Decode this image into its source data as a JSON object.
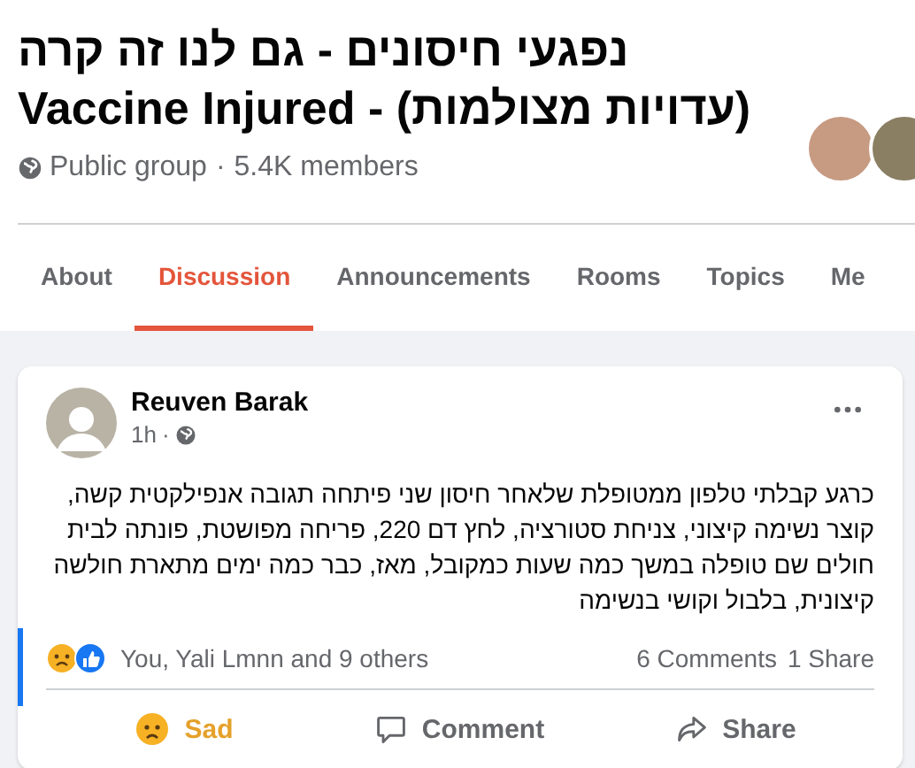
{
  "group": {
    "title": "נפגעי חיסונים - גם לנו זה קרה (עדויות מצולמות) - Vaccine Injured",
    "privacy": "Public group",
    "separator": "·",
    "members": "5.4K members"
  },
  "tabs": [
    {
      "label": "About",
      "selected": false
    },
    {
      "label": "Discussion",
      "selected": true
    },
    {
      "label": "Announcements",
      "selected": false
    },
    {
      "label": "Rooms",
      "selected": false
    },
    {
      "label": "Topics",
      "selected": false
    },
    {
      "label": "Me",
      "selected": false
    }
  ],
  "post": {
    "author": "Reuven Barak",
    "time": "1h",
    "separator": "·",
    "text": "כרגע קבלתי טלפון ממטופלת שלאחר חיסון שני פיתחה תגובה אנפילקטית קשה, קוצר נשימה קיצוני, צניחת סטורציה, לחץ דם 220, פריחה מפושטת, פונתה לבית חולים שם טופלה במשך כמה שעות כמקובל, מאז, כבר כמה ימים מתארת חולשה קיצונית, בלבול וקושי בנשימה",
    "reactions_summary": "You, Yali Lmnn and 9 others",
    "comments": "6 Comments",
    "shares": "1 Share",
    "actions": [
      {
        "kind": "sad",
        "label": "Sad",
        "selected": true
      },
      {
        "kind": "comment",
        "label": "Comment",
        "selected": false
      },
      {
        "kind": "share",
        "label": "Share",
        "selected": false
      }
    ]
  }
}
